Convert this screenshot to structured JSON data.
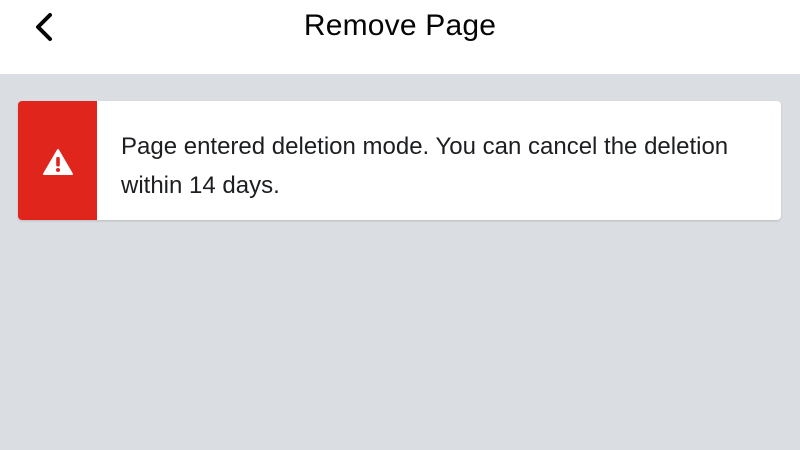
{
  "header": {
    "title": "Remove Page",
    "back_icon": "chevron-left-icon"
  },
  "notice": {
    "type": "warning",
    "icon": "warning-triangle-icon",
    "accent_color": "#e0251d",
    "message": "Page entered deletion mode. You can cancel the deletion within 14 days."
  },
  "colors": {
    "page_background": "#dadde1",
    "header_background": "#ffffff",
    "text_primary": "#050505"
  }
}
